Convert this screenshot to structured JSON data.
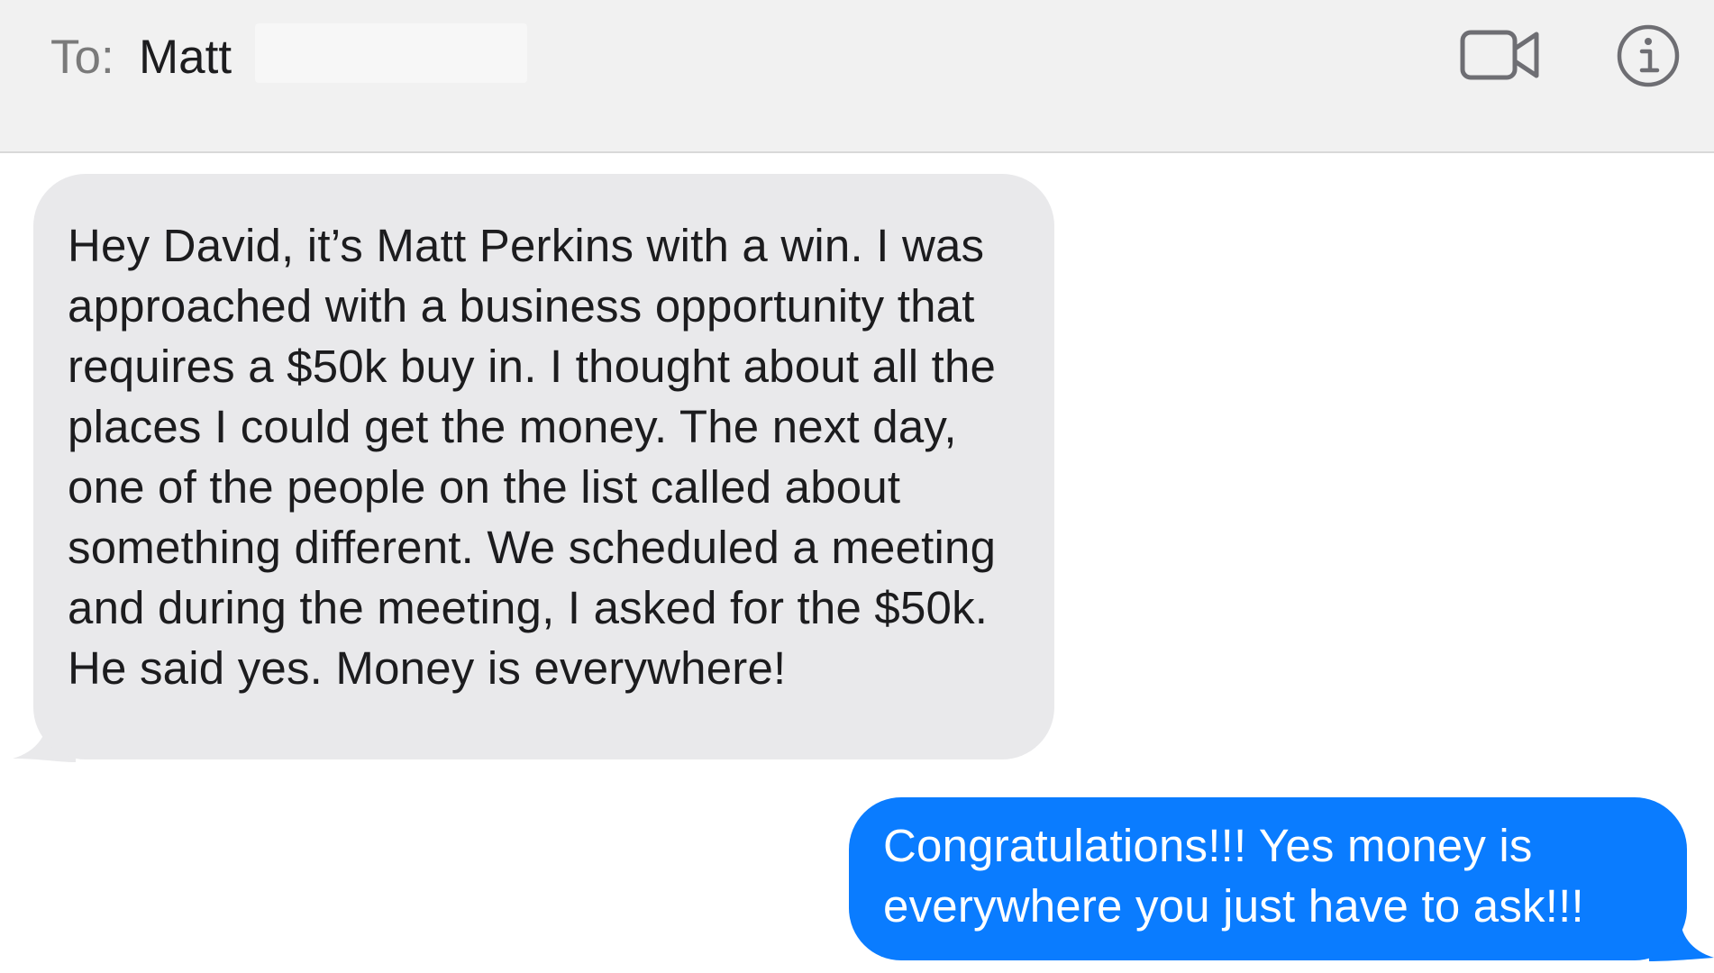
{
  "header": {
    "to_label": "To:",
    "recipient_name": "Matt",
    "icons": {
      "video": "video-camera-icon",
      "info": "info-icon"
    }
  },
  "conversation": {
    "messages": [
      {
        "direction": "incoming",
        "text": "Hey David, it’s Matt Perkins with a win. I was approached with a business opportunity that requires a $50k buy in. I thought about all the places I could get the money. The next day, one of the people on the list called about something different. We scheduled a meeting and during the meeting, I asked for the $50k. He said yes. Money is everywhere!"
      },
      {
        "direction": "outgoing",
        "text": "Congratulations!!! Yes money is everywhere you just have to ask!!!"
      }
    ]
  },
  "colors": {
    "header_bg": "#f1f1f1",
    "incoming_bubble": "#e9e9eb",
    "outgoing_bubble": "#0a7cff",
    "icon_gray": "#6e6e73"
  }
}
